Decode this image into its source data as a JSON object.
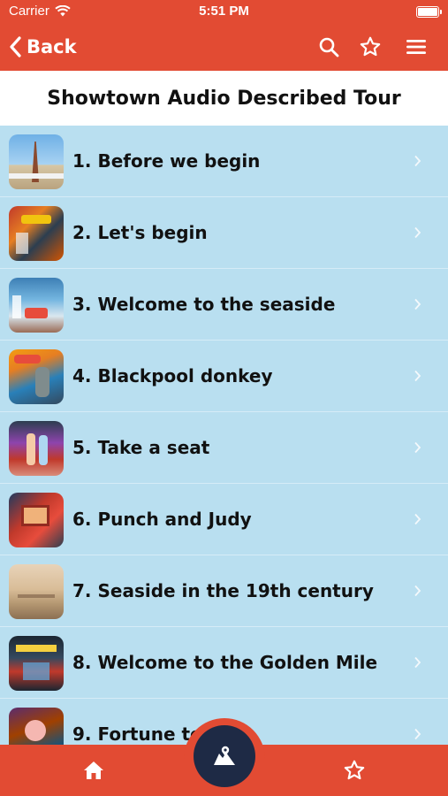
{
  "status": {
    "carrier": "Carrier",
    "time": "5:51 PM"
  },
  "nav": {
    "back_label": "Back"
  },
  "page_title": "Showtown Audio Described Tour",
  "tour_items": [
    {
      "label": "1. Before we begin"
    },
    {
      "label": "2. Let's begin"
    },
    {
      "label": "3. Welcome to the seaside"
    },
    {
      "label": "4. Blackpool donkey"
    },
    {
      "label": "5. Take a seat"
    },
    {
      "label": "6. Punch and Judy"
    },
    {
      "label": "7. Seaside in the 19th century"
    },
    {
      "label": "8. Welcome to the Golden Mile"
    },
    {
      "label": "9. Fortune teller"
    }
  ],
  "colors": {
    "header": "#e24b33",
    "list_background": "#b9dff0",
    "center_button": "#1e2a45"
  },
  "icons": {
    "nav": [
      "search-icon",
      "star-icon",
      "menu-icon"
    ],
    "tabs": [
      "home-icon",
      "map-icon",
      "star-icon"
    ]
  }
}
